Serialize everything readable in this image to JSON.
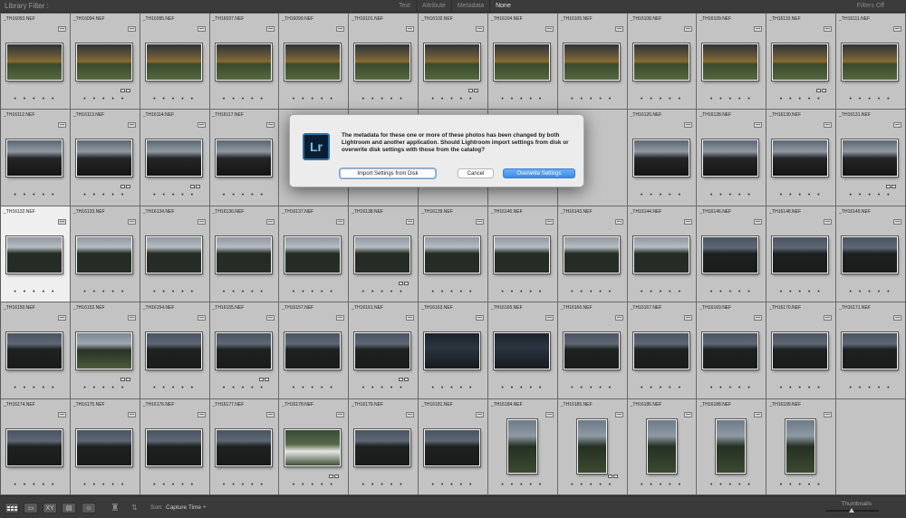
{
  "filter_bar": {
    "title": "Library Filter :",
    "options": [
      "Text",
      "Attribute",
      "Metadata",
      "None"
    ],
    "active": "None",
    "preset": "Filters Off"
  },
  "grid": {
    "rows": [
      [
        "_TH16093.NEF",
        "_TH16094.NEF",
        "_TH16095.NEF",
        "_TH16097.NEF",
        "_TH16099.NEF",
        "_TH16101.NEF",
        "_TH16102.NEF",
        "_TH16104.NEF",
        "_TH16105.NEF",
        "_TH16108.NEF",
        "_TH16109.NEF",
        "_TH16110.NEF",
        "_TH16111.NEF"
      ],
      [
        "_TH16112.NEF",
        "_TH16113.NEF",
        "_TH16114.NEF",
        "_TH16117.NEF",
        "",
        "",
        "",
        "",
        "",
        "_TH16126.NEF",
        "_TH16128.NEF",
        "_TH16130.NEF",
        "_TH16131.NEF"
      ],
      [
        "_TH16132.NEF",
        "_TH16133.NEF",
        "_TH16134.NEF",
        "_TH16136.NEF",
        "_TH16137.NEF",
        "_TH16138.NEF",
        "_TH16139.NEF",
        "_TH16140.NEF",
        "_TH16143.NEF",
        "_TH16144.NEF",
        "_TH16146.NEF",
        "_TH16148.NEF",
        "_TH16149.NEF"
      ],
      [
        "_TH16150.NEF",
        "_TH16152.NEF",
        "_TH16154.NEF",
        "_TH16155.NEF",
        "_TH16157.NEF",
        "_TH16161.NEF",
        "_TH16163.NEF",
        "_TH16165.NEF",
        "_TH16166.NEF",
        "_TH16167.NEF",
        "_TH16169.NEF",
        "_TH16170.NEF",
        "_TH16171.NEF"
      ],
      [
        "_TH16174.NEF",
        "_TH16175.NEF",
        "_TH16176.NEF",
        "_TH16177.NEF",
        "_TH16178.NEF",
        "_TH16179.NEF",
        "_TH16181.NEF",
        "_TH16184.NEF",
        "_TH16185.NEF",
        "_TH16186.NEF",
        "_TH16188.NEF",
        "_TH16189.NEF",
        ""
      ]
    ],
    "rating_dots": "• • • • •",
    "selected_file": "_TH16132.NEF"
  },
  "dialog": {
    "app_icon": "Lr",
    "message": "The metadata for these one or more of these photos has been changed by both Lightroom and another application. Should Lightroom import settings from disk or overwrite disk settings with those from the catalog?",
    "import_label": "Import Settings from Disk",
    "cancel_label": "Cancel",
    "overwrite_label": "Overwrite Settings"
  },
  "toolbar": {
    "sort_label": "Sort:",
    "sort_value": "Capture Time ÷",
    "thumbnails_label": "Thumbnails"
  },
  "icons": [
    "grid-view-icon",
    "loupe-view-icon",
    "compare-view-icon",
    "survey-view-icon",
    "people-view-icon",
    "painter-spray-icon",
    "sort-direction-icon",
    "metadata-badge-icon",
    "cell-menu-icon"
  ],
  "colors": {
    "accent": "#3d8ae8",
    "lr_blue": "#7cc2f2",
    "lr_bg": "#0b1e31"
  }
}
